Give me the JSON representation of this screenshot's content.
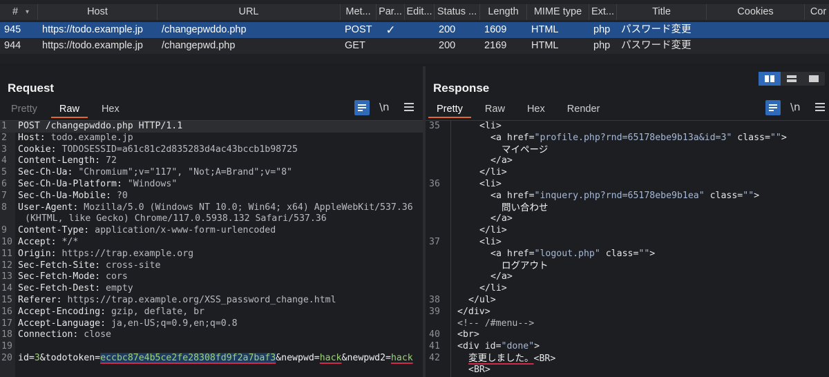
{
  "history": {
    "columns": [
      "#",
      "Host",
      "URL",
      "Met...",
      "Par...",
      "Edit...",
      "Status ...",
      "Length",
      "MIME type",
      "Ext...",
      "Title",
      "Cookies",
      "Cor"
    ],
    "rows": [
      [
        "945",
        "https://todo.example.jp",
        "/changepwddo.php",
        "POST",
        "✓",
        "",
        "200",
        "1609",
        "HTML",
        "php",
        "パスワード変更",
        "",
        ""
      ],
      [
        "944",
        "https://todo.example.jp",
        "/changepwd.php",
        "GET",
        "",
        "",
        "200",
        "2169",
        "HTML",
        "php",
        "パスワード変更",
        "",
        ""
      ]
    ]
  },
  "request": {
    "title": "Request",
    "tabs": [
      "Pretty",
      "Raw",
      "Hex"
    ],
    "active_tab": "Raw",
    "newline_label": "\\n",
    "lines": [
      {
        "n": "1",
        "name": "POST /changepwddo.php HTTP/1.1",
        "value": ""
      },
      {
        "n": "2",
        "name": "Host:",
        "value": " todo.example.jp"
      },
      {
        "n": "3",
        "name": "Cookie:",
        "value": " TODOSESSID=a61c81c2d835283d4ac43bccb1b98725"
      },
      {
        "n": "4",
        "name": "Content-Length:",
        "value": " 72"
      },
      {
        "n": "5",
        "name": "Sec-Ch-Ua:",
        "value": " \"Chromium\";v=\"117\", \"Not;A=Brand\";v=\"8\""
      },
      {
        "n": "6",
        "name": "Sec-Ch-Ua-Platform:",
        "value": " \"Windows\""
      },
      {
        "n": "7",
        "name": "Sec-Ch-Ua-Mobile:",
        "value": " ?0"
      },
      {
        "n": "8",
        "name": "User-Agent:",
        "value": " Mozilla/5.0 (Windows NT 10.0; Win64; x64) AppleWebKit/537.36"
      },
      {
        "n": "",
        "name": "",
        "value": "(KHTML, like Gecko) Chrome/117.0.5938.132 Safari/537.36"
      },
      {
        "n": "9",
        "name": "Content-Type:",
        "value": " application/x-www-form-urlencoded"
      },
      {
        "n": "10",
        "name": "Accept:",
        "value": " */*"
      },
      {
        "n": "11",
        "name": "Origin:",
        "value": " https://trap.example.org"
      },
      {
        "n": "12",
        "name": "Sec-Fetch-Site:",
        "value": " cross-site"
      },
      {
        "n": "13",
        "name": "Sec-Fetch-Mode:",
        "value": " cors"
      },
      {
        "n": "14",
        "name": "Sec-Fetch-Dest:",
        "value": " empty"
      },
      {
        "n": "15",
        "name": "Referer:",
        "value": " https://trap.example.org/XSS_password_change.html"
      },
      {
        "n": "16",
        "name": "Accept-Encoding:",
        "value": " gzip, deflate, br"
      },
      {
        "n": "17",
        "name": "Accept-Language:",
        "value": " ja,en-US;q=0.9,en;q=0.8"
      },
      {
        "n": "18",
        "name": "Connection:",
        "value": " close"
      },
      {
        "n": "19",
        "name": "",
        "value": ""
      }
    ],
    "body_line": {
      "n": "20",
      "p1": "id=",
      "v1": "3",
      "p2": "&todotoken=",
      "v2": "eccbc87e4b5ce2fe28308fd9f2a7baf3",
      "p3": "&newpwd=",
      "v3": "hack",
      "p4": "&newpwd2=",
      "v4": "hack"
    }
  },
  "response": {
    "title": "Response",
    "tabs": [
      "Pretty",
      "Raw",
      "Hex",
      "Render"
    ],
    "active_tab": "Pretty",
    "newline_label": "\\n",
    "lines": [
      {
        "n": "35",
        "indent": 5,
        "parts": [
          [
            "t",
            "<li>"
          ]
        ]
      },
      {
        "n": "",
        "indent": 6,
        "parts": [
          [
            "t",
            "<a "
          ],
          [
            "a",
            "href="
          ],
          [
            "v",
            "\"profile.php?rnd=65178ebe9b13a&id=3\""
          ],
          [
            "a",
            " class="
          ],
          [
            "v",
            "\"\""
          ],
          [
            "t",
            ">"
          ]
        ]
      },
      {
        "n": "",
        "indent": 7,
        "parts": [
          [
            "b",
            "マイページ"
          ]
        ]
      },
      {
        "n": "",
        "indent": 6,
        "parts": [
          [
            "t",
            "</a>"
          ]
        ]
      },
      {
        "n": "",
        "indent": 5,
        "parts": [
          [
            "t",
            "</li>"
          ]
        ]
      },
      {
        "n": "36",
        "indent": 5,
        "parts": [
          [
            "t",
            "<li>"
          ]
        ]
      },
      {
        "n": "",
        "indent": 6,
        "parts": [
          [
            "t",
            "<a "
          ],
          [
            "a",
            "href="
          ],
          [
            "v",
            "\"inquery.php?rnd=65178ebe9b1ea\""
          ],
          [
            "a",
            " class="
          ],
          [
            "v",
            "\"\""
          ],
          [
            "t",
            ">"
          ]
        ]
      },
      {
        "n": "",
        "indent": 7,
        "parts": [
          [
            "b",
            "問い合わせ"
          ]
        ]
      },
      {
        "n": "",
        "indent": 6,
        "parts": [
          [
            "t",
            "</a>"
          ]
        ]
      },
      {
        "n": "",
        "indent": 5,
        "parts": [
          [
            "t",
            "</li>"
          ]
        ]
      },
      {
        "n": "37",
        "indent": 5,
        "parts": [
          [
            "t",
            "<li>"
          ]
        ]
      },
      {
        "n": "",
        "indent": 6,
        "parts": [
          [
            "t",
            "<a "
          ],
          [
            "a",
            "href="
          ],
          [
            "v",
            "\"logout.php\""
          ],
          [
            "a",
            " class="
          ],
          [
            "v",
            "\"\""
          ],
          [
            "t",
            ">"
          ]
        ]
      },
      {
        "n": "",
        "indent": 7,
        "parts": [
          [
            "b",
            "ログアウト"
          ]
        ]
      },
      {
        "n": "",
        "indent": 6,
        "parts": [
          [
            "t",
            "</a>"
          ]
        ]
      },
      {
        "n": "",
        "indent": 5,
        "parts": [
          [
            "t",
            "</li>"
          ]
        ]
      },
      {
        "n": "38",
        "indent": 4,
        "parts": [
          [
            "t",
            "</ul>"
          ]
        ]
      },
      {
        "n": "39",
        "indent": 3,
        "parts": [
          [
            "t",
            "</div>"
          ]
        ]
      },
      {
        "n": "",
        "indent": 3,
        "parts": [
          [
            "c",
            "<!-- /#menu-->"
          ]
        ]
      },
      {
        "n": "40",
        "indent": 3,
        "parts": [
          [
            "t",
            "<br>"
          ]
        ]
      },
      {
        "n": "41",
        "indent": 3,
        "parts": [
          [
            "t",
            "<div "
          ],
          [
            "a",
            "id="
          ],
          [
            "v",
            "\"done\""
          ],
          [
            "t",
            ">"
          ]
        ]
      },
      {
        "n": "42",
        "indent": 4,
        "parts": [
          [
            "bu",
            "変更しました。"
          ],
          [
            "t",
            "<BR>"
          ]
        ]
      },
      {
        "n": "",
        "indent": 4,
        "parts": [
          [
            "t",
            "<BR>"
          ]
        ]
      }
    ]
  },
  "colors": {
    "selected_row": "#224f8c",
    "active_tab_underline": "#e8672b",
    "highlight_underline": "#d42a4a",
    "param_value": "#9fd27a"
  },
  "icons": [
    "word-wrap-icon",
    "newline-icon",
    "hamburger-menu-icon",
    "chevron-down-icon",
    "checkmark-icon",
    "layout-split-icon"
  ]
}
